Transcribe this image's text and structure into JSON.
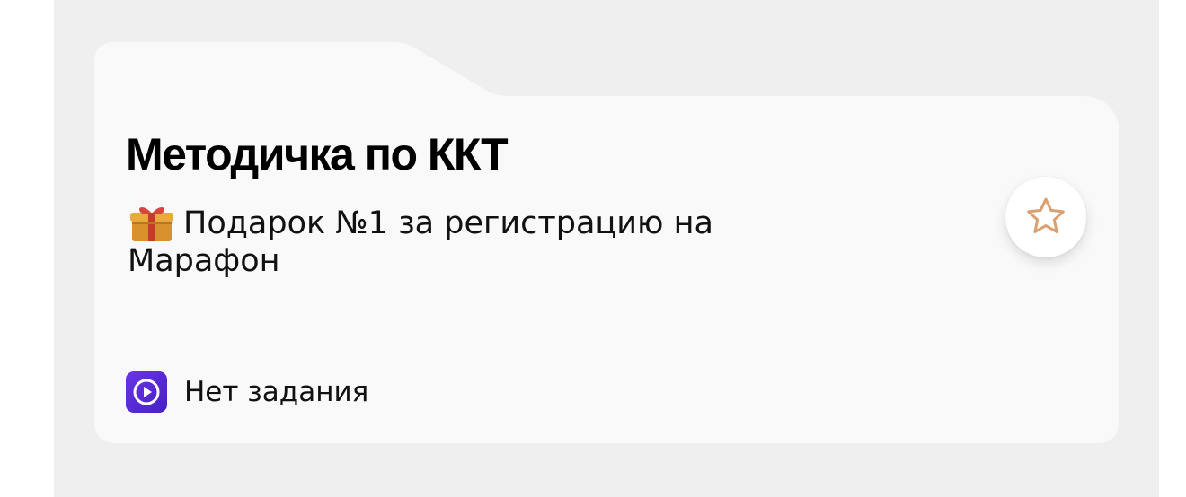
{
  "card": {
    "title": "Методичка по ККТ",
    "subtitle": "Подарок №1 за регистрацию на Марафон",
    "gift_icon": "wrapped-gift-icon",
    "favorite_icon": "star-outline-icon",
    "task_icon": "play-circle-icon",
    "task_status": "Нет задания"
  },
  "colors": {
    "background": "#efefef",
    "card": "#f9f9f9",
    "star": "#dba071",
    "play_badge": "#5b2bd6"
  }
}
